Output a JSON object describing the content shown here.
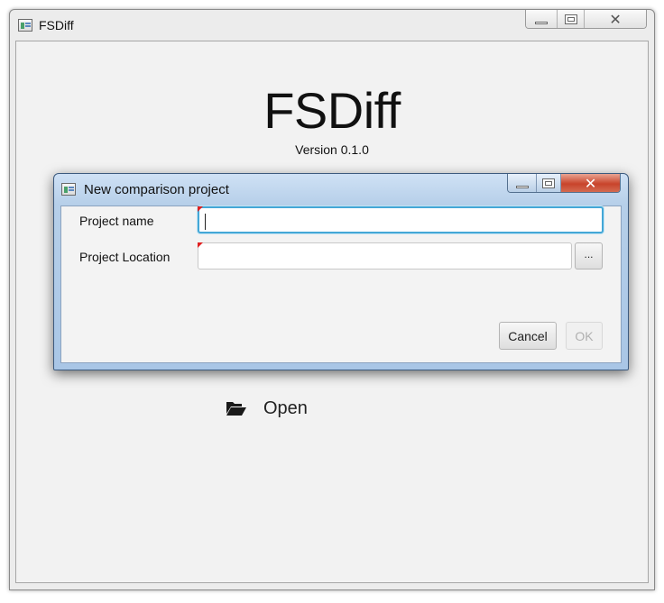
{
  "main_window": {
    "title": "FSDiff",
    "heading": "FSDiff",
    "version": "Version 0.1.0",
    "open_label": "Open"
  },
  "dialog": {
    "title": "New comparison project",
    "project_name_label": "Project name",
    "project_name_value": "",
    "project_location_label": "Project Location",
    "project_location_value": "",
    "browse_label": "...",
    "cancel_label": "Cancel",
    "ok_label": "OK",
    "ok_enabled": false
  },
  "colors": {
    "focus_border": "#44a7d6",
    "required_marker": "#e02020",
    "close_button": "#c8442b"
  },
  "icons": {
    "app": "app-window-icon",
    "open": "folder-open-icon",
    "minimize": "minimize-icon",
    "maximize": "maximize-icon",
    "close": "close-icon"
  }
}
